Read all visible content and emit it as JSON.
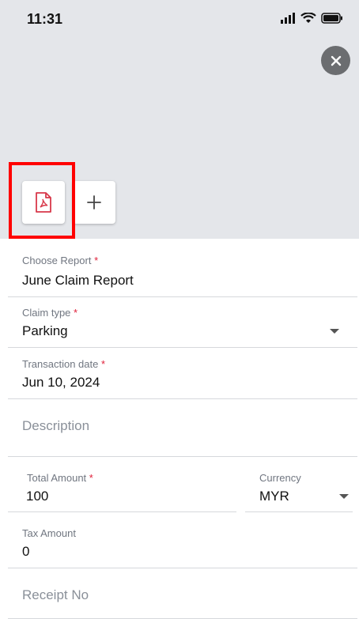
{
  "status": {
    "time": "11:31"
  },
  "form": {
    "choose_report": {
      "label": "Choose Report",
      "required": "*",
      "value": "June Claim Report"
    },
    "claim_type": {
      "label": "Claim type",
      "required": "*",
      "value": "Parking"
    },
    "transaction_date": {
      "label": "Transaction date",
      "required": "*",
      "value": "Jun 10, 2024"
    },
    "description": {
      "placeholder": "Description"
    },
    "total_amount": {
      "label": "Total Amount",
      "required": "*",
      "value": "100"
    },
    "currency": {
      "label": "Currency",
      "value": "MYR"
    },
    "tax_amount": {
      "label": "Tax Amount",
      "value": "0"
    },
    "receipt_no": {
      "placeholder": "Receipt No"
    }
  },
  "icons": {
    "close": "close-icon",
    "pdf": "pdf-icon",
    "add": "plus-icon"
  },
  "colors": {
    "accent_required": "#e0213a",
    "pdf_red": "#d8384a",
    "highlight": "#ff0000",
    "header_bg": "#e4e6ea"
  }
}
